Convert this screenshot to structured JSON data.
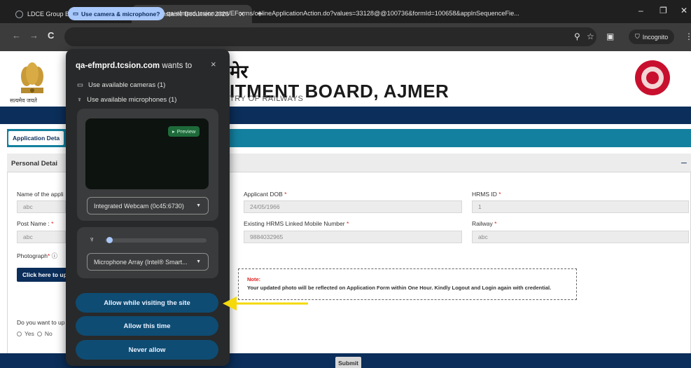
{
  "browser": {
    "tabs": [
      {
        "label": "LDCE Group B Promotion 2026",
        "active": false
      },
      {
        "label": "PP Constable Document 2026",
        "active": true
      }
    ],
    "new_tab": "+",
    "window_controls": {
      "minimize": "–",
      "restore": "❐",
      "close": "✕"
    },
    "nav": {
      "back": "←",
      "forward": "→",
      "reload": "C"
    },
    "permission_chip": "Use camera & microphone?",
    "url": "qa-efmprd.tcsion.com/EForms/onlineApplicationAction.do?values=33128@@100736&formId=100658&applnSequenceFie...",
    "incognito_label": "Incognito",
    "icons": {
      "zoom": "search-icon",
      "bookmark": "star-icon",
      "sidepanel": "side-panel-icon",
      "menu": "more-vert-icon"
    }
  },
  "page": {
    "header": {
      "emblem_caption": "सत्यमेव जयते",
      "title_hindi_fragment": "मेर",
      "title_english_fragment": "ITMENT BOARD, AJMER",
      "subtitle_fragment": "TRY OF RAILWAYS"
    },
    "application_tab": "Application Deta",
    "panel_title": "Personal Detai",
    "panel_toggle": "–",
    "fields": {
      "name_label": "Name of the appli",
      "name_value": "abc",
      "dob_label": "Applicant DOB",
      "dob_value": "24/05/1966",
      "hrms_label": "HRMS ID",
      "hrms_value": "1",
      "post_label": "Post Name :",
      "post_value": "abc",
      "mobile_label": "Existing HRMS Linked Mobile Number",
      "mobile_value": "9884032965",
      "railway_label": "Railway",
      "railway_value": "abc",
      "photo_label": "Photograph",
      "required_mark": "*"
    },
    "upload_button": "Click here to up",
    "note_title": "Note:",
    "note_text": "Your updated photo will be reflected on Application Form within One Hour. Kindly Logout and Login again with credential.",
    "question": "Do you want to up",
    "radio_yes": "Yes",
    "radio_no": "No",
    "submit": "Submit"
  },
  "popup": {
    "site": "qa-efmprd.tcsion.com",
    "wants_to": "wants to",
    "close": "×",
    "cameras": "Use available cameras (1)",
    "microphones": "Use available microphones (1)",
    "preview_badge": "Preview",
    "camera_select": "Integrated Webcam (0c45:6730)",
    "mic_select": "Microphone Array (Intel® Smart...",
    "mic_level": 0.02,
    "buttons": {
      "allow_site": "Allow while visiting the site",
      "allow_once": "Allow this time",
      "never": "Never allow"
    }
  },
  "annotation": {
    "arrow_color": "#f5d90a"
  },
  "colors": {
    "navy": "#0b2e5a",
    "teal": "#13809f",
    "chip": "#a8c7fa",
    "popup_bg": "#28292a",
    "popup_btn": "#0e4c73"
  }
}
